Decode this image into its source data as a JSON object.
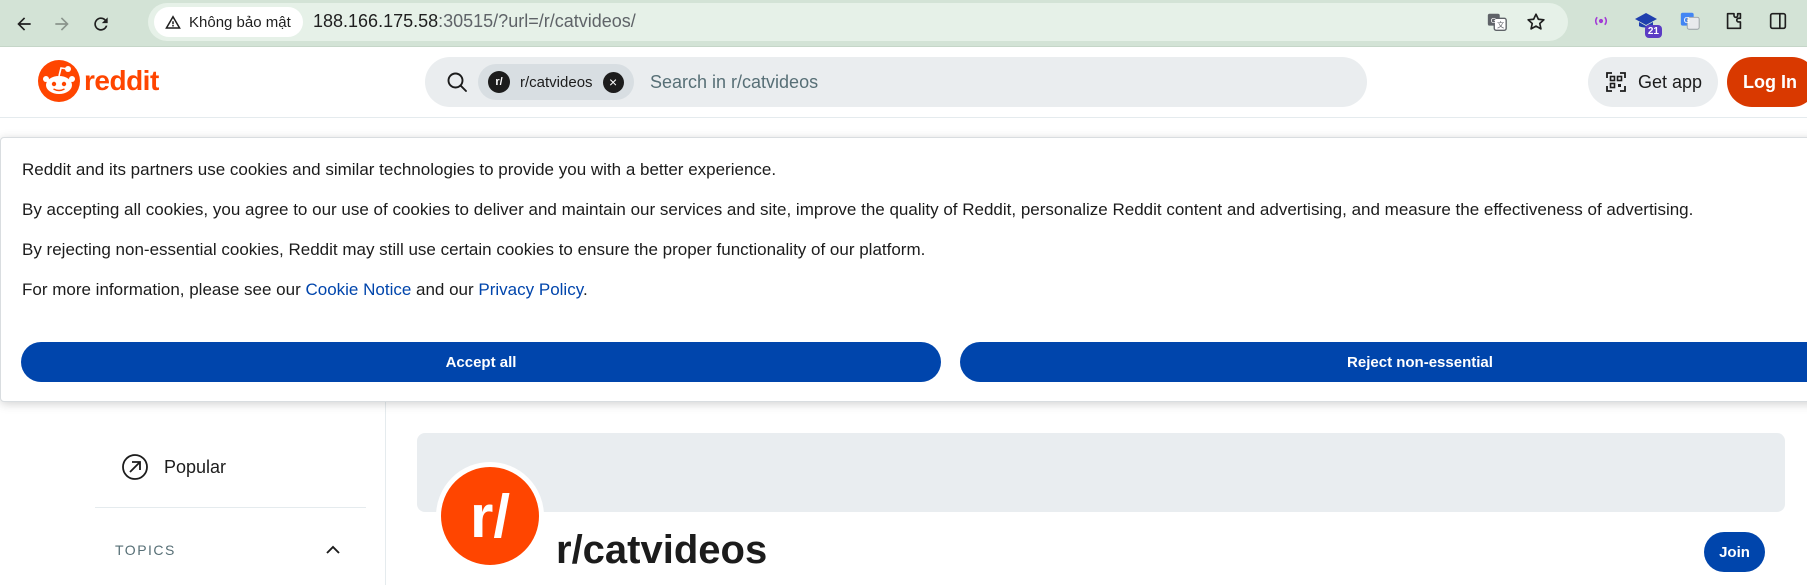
{
  "browser": {
    "security_label": "Không bảo mật",
    "url_host": "188.166.175.58",
    "url_rest": ":30515/?url=/r/catvideos/",
    "extension_badge": "21"
  },
  "header": {
    "logo_text": "reddit",
    "search_chip_avatar": "r/",
    "search_chip_label": "r/catvideos",
    "search_placeholder": "Search in r/catvideos",
    "get_app_label": "Get app",
    "login_label": "Log In"
  },
  "cookie_banner": {
    "line1": "Reddit and its partners use cookies and similar technologies to provide you with a better experience.",
    "line2": "By accepting all cookies, you agree to our use of cookies to deliver and maintain our services and site, improve the quality of Reddit, personalize Reddit content and advertising, and measure the effectiveness of advertising.",
    "line3": "By rejecting non-essential cookies, Reddit may still use certain cookies to ensure the proper functionality of our platform.",
    "line4_prefix": "For more information, please see our ",
    "cookie_notice_link": "Cookie Notice",
    "line4_middle": " and our ",
    "privacy_policy_link": "Privacy Policy",
    "line4_suffix": ".",
    "accept_label": "Accept all",
    "reject_label": "Reject non-essential"
  },
  "sidebar": {
    "popular_label": "Popular",
    "topics_label": "TOPICS"
  },
  "community": {
    "avatar_text": "r/",
    "name": "r/catvideos",
    "join_label": "Join"
  },
  "colors": {
    "brand": "#ff4500",
    "login": "#d93900",
    "primary_button": "#0045ac",
    "chrome_bar": "#d3e3d6"
  }
}
